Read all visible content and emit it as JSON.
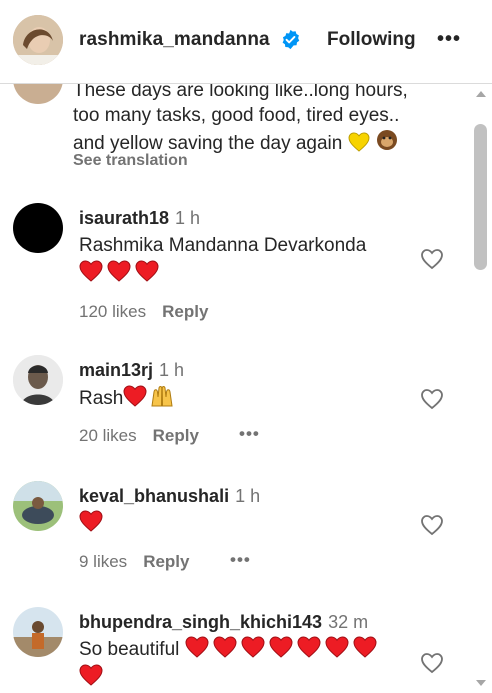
{
  "header": {
    "username": "rashmika_mandanna",
    "follow_status": "Following",
    "more_label": "•••"
  },
  "caption": {
    "line1": "These days are looking like..long hours,",
    "line2": "too many tasks, good food, tired eyes..",
    "line3": "and yellow saving the day again",
    "see_translation": "See translation"
  },
  "comments": [
    {
      "username": "isaurath18",
      "time": "1 h",
      "text": "Rashmika Mandanna Devarkonda",
      "likes": "120 likes",
      "reply": "Reply"
    },
    {
      "username": "main13rj",
      "time": "1 h",
      "text": "Rash",
      "likes": "20 likes",
      "reply": "Reply",
      "more": "•••"
    },
    {
      "username": "keval_bhanushali",
      "time": "1 h",
      "text": "",
      "likes": "9 likes",
      "reply": "Reply",
      "more": "•••"
    },
    {
      "username": "bhupendra_singh_khichi143",
      "time": "32 m",
      "text": "So beautiful"
    }
  ],
  "colors": {
    "heart_red": "#ed1c24",
    "verified_blue": "#0095f6",
    "muted": "#737373"
  }
}
